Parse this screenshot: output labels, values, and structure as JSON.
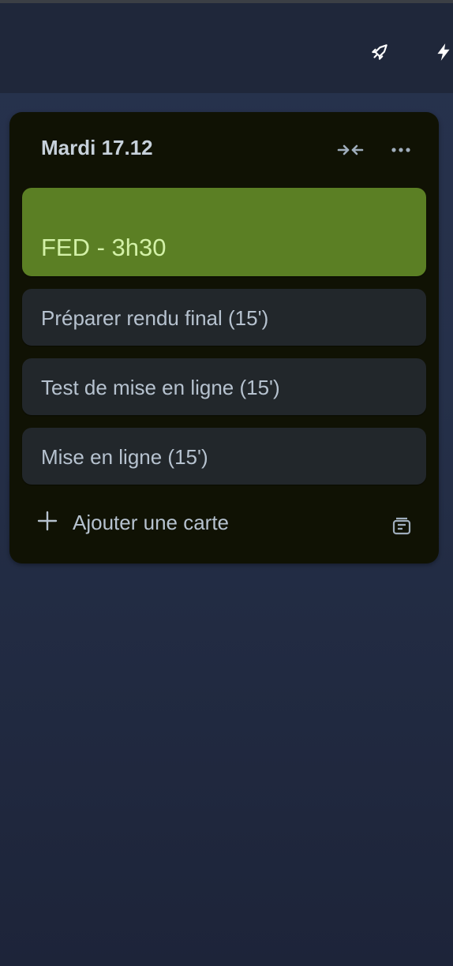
{
  "topbar": {
    "icons": [
      "rocket-icon",
      "lightning-icon"
    ]
  },
  "list": {
    "title": "Mardi 17.12",
    "header_icons": [
      "collapse-arrows-icon",
      "more-dots-icon"
    ],
    "cards": [
      {
        "text": "FED - 3h30",
        "color": "#5b7f24",
        "text_color": "#d3f1a7"
      },
      {
        "text": "Préparer rendu final (15')"
      },
      {
        "text": "Test de mise en ligne (15')"
      },
      {
        "text": "Mise en ligne (15')"
      }
    ],
    "add_card_label": "Ajouter une carte",
    "template_icon": "card-template-icon"
  },
  "colors": {
    "list_background": "#101204",
    "card_background": "#22272b",
    "text": "#b6c2cf"
  }
}
